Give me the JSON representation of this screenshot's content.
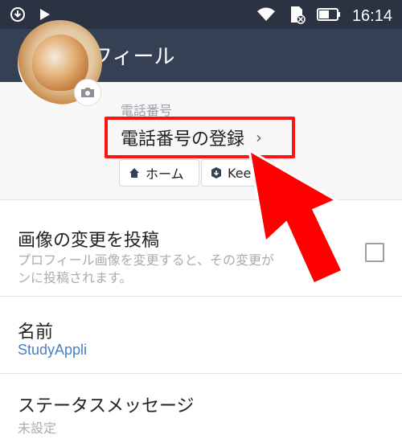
{
  "status_bar": {
    "left_icons": [
      "download-icon",
      "play-icon"
    ],
    "right_icons": [
      "wifi-icon",
      "sd-card-icon",
      "battery-icon"
    ],
    "time": "16:14"
  },
  "app_bar": {
    "title": "プロフィール",
    "back_icon": "back-chevron-icon"
  },
  "profile": {
    "phone_label": "電話番号",
    "phone_register_label": "電話番号の登録",
    "phone_register_chevron": "›",
    "buttons": {
      "home": {
        "label": "ホーム",
        "icon": "home-icon"
      },
      "keep": {
        "label": "Kee",
        "icon": "keep-icon"
      }
    }
  },
  "rows": {
    "post_change": {
      "title": "画像の変更を投稿",
      "description": "プロフィール画像を変更すると、その変更が　　ライン　ンに投稿されます。"
    },
    "name": {
      "title": "名前",
      "value": "StudyAppli"
    },
    "status_message": {
      "title": "ステータスメッセージ",
      "value": "未設定"
    }
  },
  "colors": {
    "status_bar": "#2b3242",
    "app_bar": "#364055",
    "accent_blue": "#4a7fc1",
    "highlight_red": "#ff1212"
  }
}
